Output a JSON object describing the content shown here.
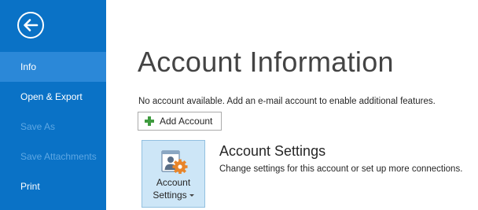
{
  "sidebar": {
    "back_icon": "back-arrow-icon",
    "items": [
      {
        "label": "Info",
        "state": "active"
      },
      {
        "label": "Open & Export",
        "state": "enabled"
      },
      {
        "label": "Save As",
        "state": "disabled"
      },
      {
        "label": "Save Attachments",
        "state": "disabled"
      },
      {
        "label": "Print",
        "state": "enabled"
      }
    ],
    "colors": {
      "background": "#0a72c6",
      "active": "#2b88d8",
      "disabled_text": "#5ea7e3"
    }
  },
  "main": {
    "title": "Account Information",
    "info_text": "No account available. Add an e-mail account to enable additional features.",
    "add_account": {
      "label": "Add Account",
      "icon": "plus-icon"
    },
    "account_settings": {
      "button_line1": "Account",
      "button_line2": "Settings",
      "icon": "account-settings-icon",
      "heading": "Account Settings",
      "description": "Change settings for this account or set up more connections."
    }
  }
}
